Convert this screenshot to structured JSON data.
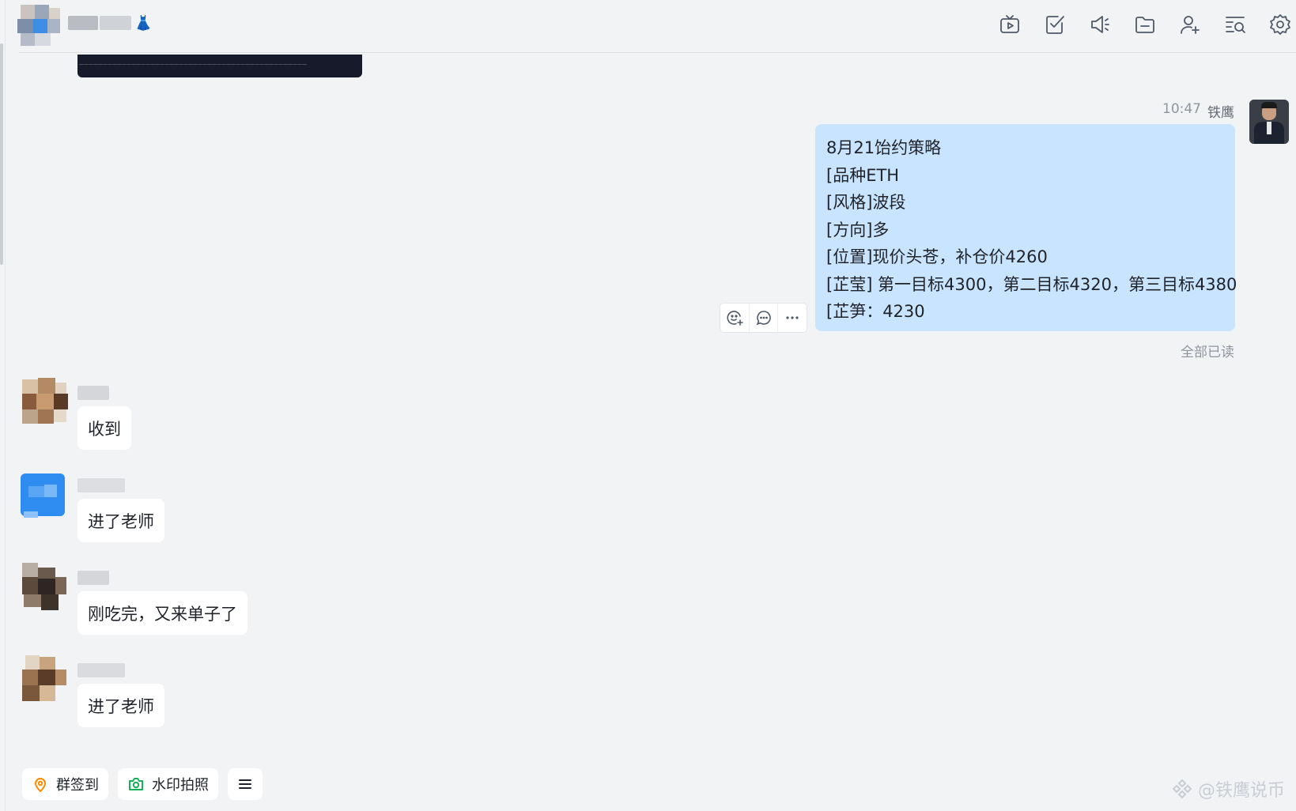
{
  "header": {
    "toolbar": [
      "live-icon",
      "task-icon",
      "announcement-icon",
      "folder-icon",
      "add-member-icon",
      "search-history-icon",
      "settings-icon"
    ]
  },
  "outgoing": {
    "time": "10:47",
    "sender": "铁鹰",
    "lines": [
      "8月21饴约策略",
      "[品种ETH",
      "[风格]波段",
      "[方向]多",
      "[位置]现价头苍，补仓价4260",
      "[芷莹] 第一目标4300，第二目标4320，第三目标4380",
      "[芷笋：4230"
    ],
    "read_status": "全部已读",
    "actions": [
      "emoji-reaction-icon",
      "reply-icon",
      "more-icon"
    ]
  },
  "incoming": [
    {
      "text": "收到"
    },
    {
      "text": "进了老师"
    },
    {
      "text": "刚吃完，又来单子了"
    },
    {
      "text": "进了老师"
    }
  ],
  "bottom": {
    "checkin_label": "群签到",
    "photo_label": "水印拍照"
  },
  "watermark": "@铁鹰说币",
  "colors": {
    "background": "#f2f3f5",
    "outgoing_bubble": "#c9e4ff",
    "incoming_bubble": "#ffffff",
    "checkin_icon": "#ff8a00",
    "photo_icon": "#16b15a"
  }
}
